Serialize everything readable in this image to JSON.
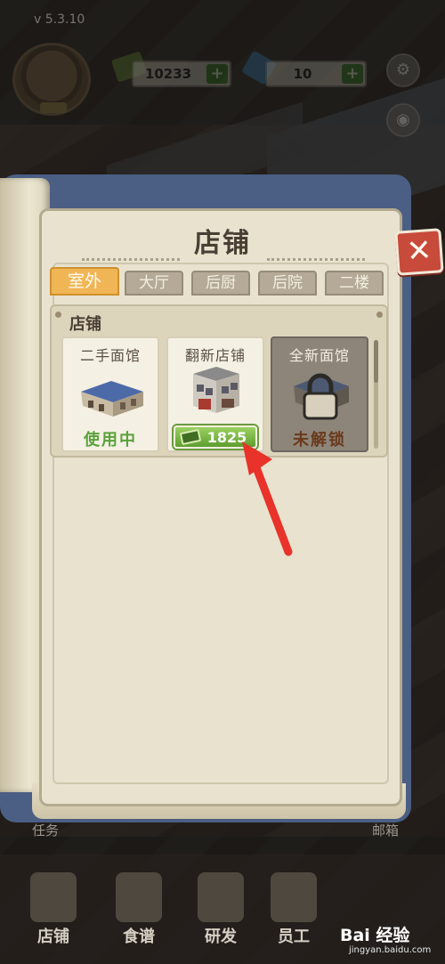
{
  "hud": {
    "version": "v 5.3.10",
    "money": "10233",
    "gems": "10",
    "plus": "+"
  },
  "modal": {
    "title": "店铺",
    "close_label": "✕",
    "tabs": [
      {
        "label": "室外",
        "active": true
      },
      {
        "label": "大厅",
        "active": false
      },
      {
        "label": "后厨",
        "active": false
      },
      {
        "label": "后院",
        "active": false
      },
      {
        "label": "二楼",
        "active": false
      }
    ],
    "section_title": "店铺",
    "cards": [
      {
        "name": "二手面馆",
        "status": "使用中"
      },
      {
        "name": "翻新店铺",
        "price": "1825"
      },
      {
        "name": "全新面馆",
        "status": "未解锁"
      }
    ]
  },
  "side_labels": {
    "left": "任务",
    "right": "邮箱"
  },
  "bottom_nav": [
    {
      "label": "店铺"
    },
    {
      "label": "食谱"
    },
    {
      "label": "研发"
    },
    {
      "label": "员工"
    }
  ],
  "watermark": {
    "main": "Bai 经验",
    "sub": "jingyan.baidu.com"
  },
  "colors": {
    "book_cover": "#4b5e84",
    "page": "#e8e2cf",
    "tab_active": "#f0b656",
    "tab_inactive": "#b4aa97",
    "close_button": "#c84a3a",
    "status_in_use": "#5aa23c",
    "price_button": "#6fb03c",
    "arrow": "#e8322a"
  }
}
